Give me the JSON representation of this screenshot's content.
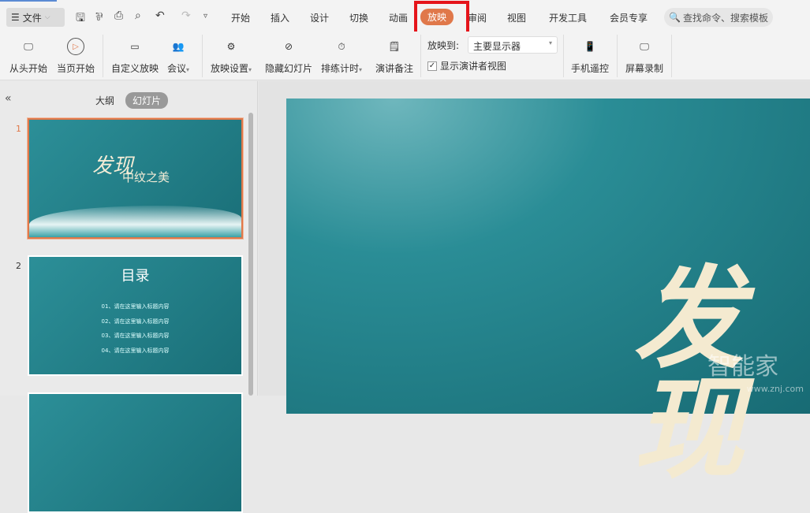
{
  "toolbar": {
    "file": "文件",
    "tabs": [
      "开始",
      "插入",
      "设计",
      "切换",
      "动画",
      "放映",
      "审阅",
      "视图",
      "开发工具",
      "会员专享"
    ],
    "search_placeholder": "查找命令、搜索模板"
  },
  "ribbon": {
    "buttons": [
      "从头开始",
      "当页开始",
      "自定义放映",
      "会议",
      "放映设置",
      "隐藏幻灯片",
      "排练计时",
      "演讲备注",
      "手机遥控",
      "屏幕录制"
    ],
    "show_to_label": "放映到:",
    "show_to_value": "主要显示器",
    "presenter_view": "显示演讲者视图",
    "presenter_view_checked": true
  },
  "panel": {
    "tabs": [
      "大纲",
      "幻灯片"
    ],
    "active_tab": "幻灯片"
  },
  "slides": [
    {
      "number": "1",
      "title": "发现",
      "subtitle": "中纹之美"
    },
    {
      "number": "2",
      "title": "目录",
      "items": [
        "01、请在这里输入标题内容",
        "02、请在这里输入标题内容",
        "03、请在这里输入标题内容",
        "04、请在这里输入标题内容"
      ]
    }
  ],
  "main_slide": {
    "title": "发现"
  },
  "watermark": {
    "text": "智能家",
    "url": "www.znj.com"
  },
  "colors": {
    "accent": "#e0784a",
    "highlight": "#e5141a",
    "slide_bg": "#1f7f88"
  }
}
